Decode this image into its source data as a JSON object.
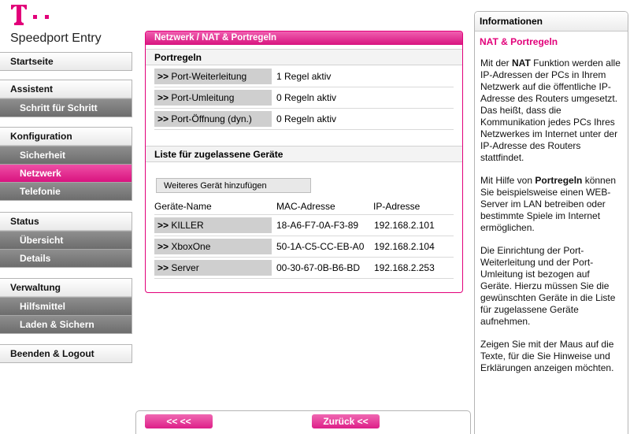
{
  "brand": {
    "name": "Speedport Entry",
    "logo_icon": "telekom-t-logo",
    "accent": "#e2007a"
  },
  "sidebar": {
    "startseite": "Startseite",
    "assistent": {
      "label": "Assistent",
      "items": [
        "Schritt für Schritt"
      ]
    },
    "konfiguration": {
      "label": "Konfiguration",
      "items": [
        "Sicherheit",
        "Netzwerk",
        "Telefonie"
      ],
      "active": "Netzwerk"
    },
    "status": {
      "label": "Status",
      "items": [
        "Übersicht",
        "Details"
      ]
    },
    "verwaltung": {
      "label": "Verwaltung",
      "items": [
        "Hilfsmittel",
        "Laden & Sichern"
      ]
    },
    "logout": "Beenden & Logout"
  },
  "main": {
    "title": "Netzwerk / NAT & Portregeln",
    "portregeln": {
      "heading": "Portregeln",
      "rows": [
        {
          "prefix": ">>",
          "label": "Port-Weiterleitung",
          "value": "1 Regel aktiv"
        },
        {
          "prefix": ">>",
          "label": "Port-Umleitung",
          "value": "0 Regeln aktiv"
        },
        {
          "prefix": ">>",
          "label": "Port-Öffnung (dyn.)",
          "value": "0 Regeln aktiv"
        }
      ]
    },
    "devices": {
      "heading": "Liste für zugelassene Geräte",
      "add_button": "Weiteres Gerät hinzufügen",
      "columns": [
        "Geräte-Name",
        "MAC-Adresse",
        "IP-Adresse"
      ],
      "rows": [
        {
          "prefix": ">>",
          "name": "KILLER",
          "mac": "18-A6-F7-0A-F3-89",
          "ip": "192.168.2.101"
        },
        {
          "prefix": ">>",
          "name": "XboxOne",
          "mac": "50-1A-C5-CC-EB-A0",
          "ip": "192.168.2.104"
        },
        {
          "prefix": ">>",
          "name": "Server",
          "mac": "00-30-67-0B-B6-BD",
          "ip": "192.168.2.253"
        }
      ]
    }
  },
  "footer": {
    "back_label": "<< <<",
    "zurueck_label": "Zurück <<"
  },
  "info": {
    "heading": "Informationen",
    "subheading": "NAT & Portregeln",
    "p1": {
      "a": "Mit der ",
      "b": "NAT",
      "c": " Funktion werden alle IP-Adressen der PCs in Ihrem Netzwerk auf die öffentliche IP-Adresse des Routers umgesetzt. Das heißt, dass die Kommunikation jedes PCs Ihres Netzwerkes im Internet unter der IP-Adresse des Routers stattfindet."
    },
    "p2": {
      "a": "Mit Hilfe von ",
      "b": "Portregeln",
      "c": " können Sie beispielsweise einen WEB-Server im LAN betreiben oder bestimmte Spiele im Internet ermöglichen."
    },
    "p3": "Die Einrichtung der Port-Weiterleitung und der Port-Umleitung ist bezogen auf Geräte. Hierzu müssen Sie die gewünschten Geräte in die Liste für zugelassene Geräte aufnehmen.",
    "p4": "Zeigen Sie mit der Maus auf die Texte, für die Sie Hinweise und Erklärungen anzeigen möchten."
  }
}
